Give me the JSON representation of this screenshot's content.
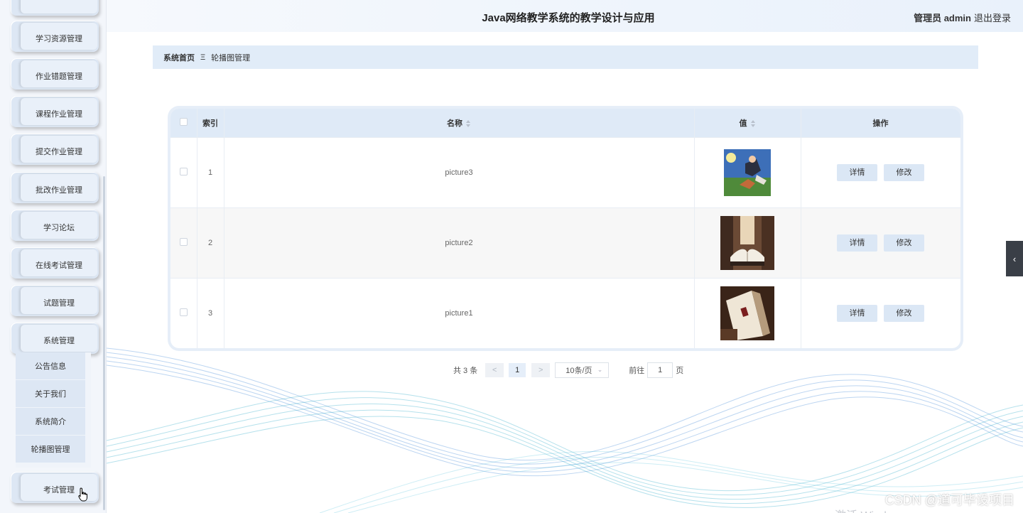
{
  "header": {
    "title": "Java网络教学系统的教学设计与应用",
    "user": "管理员 admin",
    "logout": "退出登录"
  },
  "sidebar": {
    "items": [
      {
        "label": "学习资源管理"
      },
      {
        "label": "作业错题管理"
      },
      {
        "label": "课程作业管理"
      },
      {
        "label": "提交作业管理"
      },
      {
        "label": "批改作业管理"
      },
      {
        "label": "学习论坛"
      },
      {
        "label": "在线考试管理"
      },
      {
        "label": "试题管理"
      },
      {
        "label": "系统管理"
      }
    ],
    "sub_items": [
      {
        "label": "公告信息"
      },
      {
        "label": "关于我们"
      },
      {
        "label": "系统简介"
      },
      {
        "label": "轮播图管理"
      }
    ],
    "bottom_item": "考试管理"
  },
  "breadcrumb": {
    "home": "系统首页",
    "separator": "Ξ",
    "current": "轮播图管理"
  },
  "table": {
    "headers": {
      "index": "索引",
      "name": "名称",
      "value": "值",
      "actions": "操作"
    },
    "rows": [
      {
        "index": "1",
        "name": "picture3",
        "image": "cartoon-boy-moon"
      },
      {
        "index": "2",
        "name": "picture2",
        "image": "open-book-library"
      },
      {
        "index": "3",
        "name": "picture1",
        "image": "book-spine-closeup"
      }
    ],
    "detail_label": "详情",
    "edit_label": "修改"
  },
  "pagination": {
    "total": "共 3 条",
    "prev": "<",
    "page": "1",
    "next": ">",
    "page_size": "10条/页",
    "goto_label": "前往",
    "goto_value": "1",
    "page_suffix": "页"
  },
  "drawer_icon": "‹",
  "watermark": "CSDN @道可毕设项目",
  "watermark_os": "激活 Windows"
}
